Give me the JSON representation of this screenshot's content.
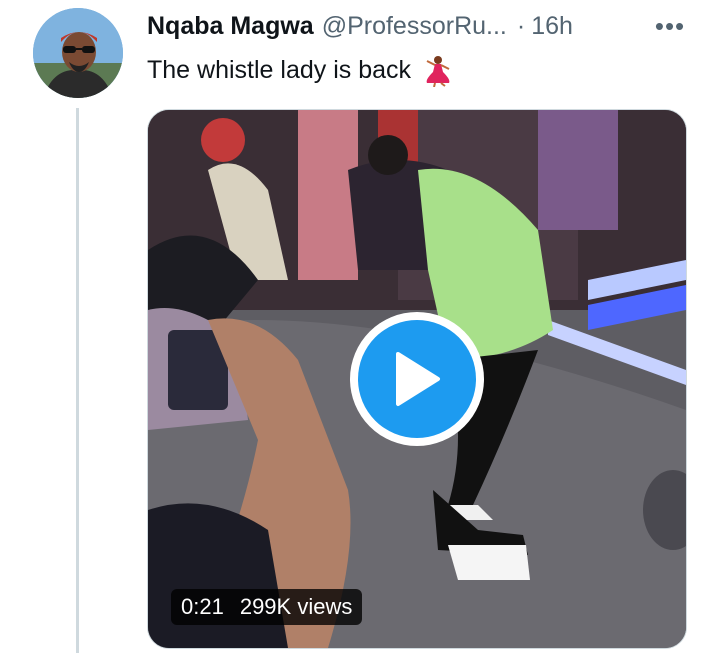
{
  "author": {
    "name": "Nqaba Magwa",
    "handle": "@ProfessorRu...",
    "separator": "·",
    "time": "16h"
  },
  "more_label": "•••",
  "tweet": {
    "text": "The whistle lady is back",
    "emoji_icon": "dancer-emoji"
  },
  "video": {
    "duration": "0:21",
    "views": "299K views"
  },
  "colors": {
    "accent": "#1d9bf0",
    "secondary_text": "#536471",
    "thread_line": "#cfd9de"
  }
}
